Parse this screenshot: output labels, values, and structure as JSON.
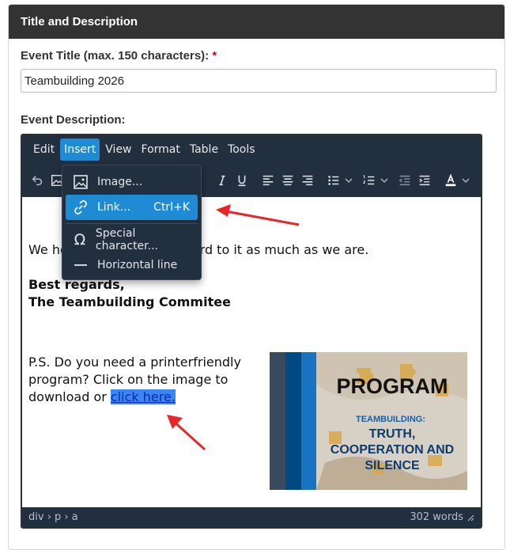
{
  "panel": {
    "title": "Title and Description"
  },
  "event_title": {
    "label": "Event Title (max. 150 characters):",
    "required_mark": "*",
    "value": "Teambuilding 2026"
  },
  "event_description": {
    "label": "Event Description:"
  },
  "editor": {
    "menubar": [
      "Edit",
      "Insert",
      "View",
      "Format",
      "Table",
      "Tools"
    ],
    "active_menu": "Insert",
    "insert_menu": [
      {
        "label": "Image...",
        "icon": "image-icon",
        "shortcut": ""
      },
      {
        "label": "Link...",
        "icon": "link-icon",
        "shortcut": "Ctrl+K"
      },
      {
        "label": "Special character...",
        "icon": "omega-icon",
        "shortcut": ""
      },
      {
        "label": "Horizontal line",
        "icon": "horizontal-line-icon",
        "shortcut": ""
      }
    ],
    "content": {
      "line1_start": "We ho",
      "line1_end": "ward to it as much as we are.",
      "regards": "Best regards,",
      "committee": "The Teambuilding Commitee",
      "ps_line1": "P.S. Do you need a printerfriendly",
      "ps_line2": "program? Click on the image to",
      "ps_line3_prefix": "download or ",
      "ps_link": "click here."
    },
    "image": {
      "heading": "PROGRAM",
      "subheading": "TEAMBUILDING:",
      "line1": "TRUTH,",
      "line2": "COOPERATION AND",
      "line3": "SILENCE"
    },
    "statusbar": {
      "path": "div › p › a",
      "word_count": "302 words"
    }
  },
  "colors": {
    "editor_dark": "#222f3e",
    "highlight": "#1f8bd4",
    "arrow": "#e8262a"
  }
}
